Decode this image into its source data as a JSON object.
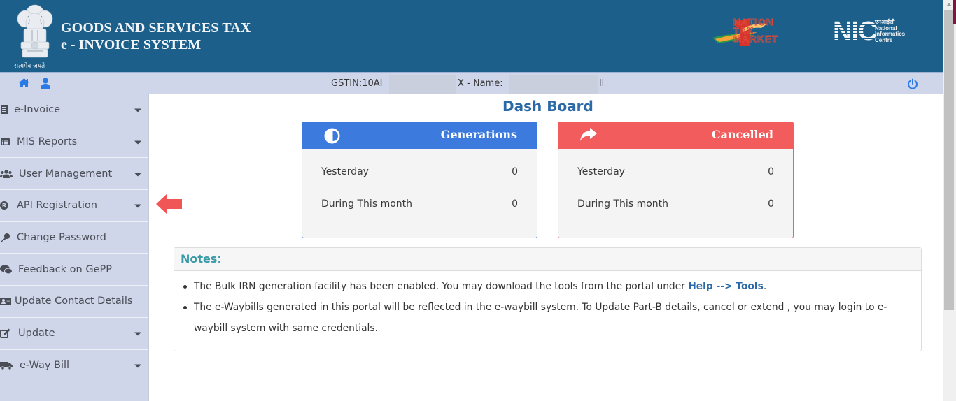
{
  "header": {
    "title_line1": "GOODS AND SERVICES TAX",
    "title_line2": "e - INVOICE SYSTEM",
    "emblem_caption": "सत्यमेव जयते",
    "partner_logo_text": [
      "NATION",
      "TAX",
      "MARKET"
    ],
    "nic_logo": {
      "abbr": "NIC",
      "hindi": "एनआईसी",
      "line1": "National",
      "line2": "Informatics",
      "line3": "Centre"
    }
  },
  "infobar": {
    "gstin_label": "GSTIN:10AI",
    "name_label": "X - Name:",
    "name_suffix": "ll"
  },
  "sidebar": {
    "items": [
      {
        "label": "e-Invoice",
        "icon": "invoice-icon",
        "has_dropdown": true
      },
      {
        "label": "MIS Reports",
        "icon": "list-icon",
        "has_dropdown": true
      },
      {
        "label": "User Management",
        "icon": "users-icon",
        "has_dropdown": true
      },
      {
        "label": "API Registration",
        "icon": "registered-icon",
        "has_dropdown": true
      },
      {
        "label": "Change Password",
        "icon": "key-icon",
        "has_dropdown": false
      },
      {
        "label": "Feedback on GePP",
        "icon": "comments-icon",
        "has_dropdown": false
      },
      {
        "label": "Update Contact Details",
        "icon": "id-card-icon",
        "has_dropdown": false
      },
      {
        "label": "Update",
        "icon": "edit-icon",
        "has_dropdown": true
      },
      {
        "label": "e-Way Bill",
        "icon": "truck-icon",
        "has_dropdown": true
      }
    ]
  },
  "main": {
    "title": "Dash Board",
    "cards": {
      "generations": {
        "title": "Generations",
        "rows": [
          {
            "label": "Yesterday",
            "value": "0"
          },
          {
            "label": "During This month",
            "value": "0"
          }
        ]
      },
      "cancelled": {
        "title": "Cancelled",
        "rows": [
          {
            "label": "Yesterday",
            "value": "0"
          },
          {
            "label": "During This month",
            "value": "0"
          }
        ]
      }
    },
    "notes": {
      "heading": "Notes:",
      "note1_text": "The Bulk IRN generation facility has been enabled. You may download the tools from the portal under ",
      "note1_link": "Help --> Tools",
      "note1_end": ".",
      "note2_text": "The e-Waybills generated in this portal will be reflected in the e-waybill system. To Update Part-B details, cancel or extend , you may login to e-waybill system with same credentials."
    }
  },
  "colors": {
    "header_bg": "#1c5f8a",
    "infobar_bg": "#cfd6ea",
    "sidebar_bg": "#cfd6ea",
    "generations_accent": "#3c7bdd",
    "cancelled_accent": "#f25c5c",
    "title_blue": "#2b6aa6",
    "notes_heading": "#3a9aa8",
    "pointer_arrow": "#f05656"
  }
}
